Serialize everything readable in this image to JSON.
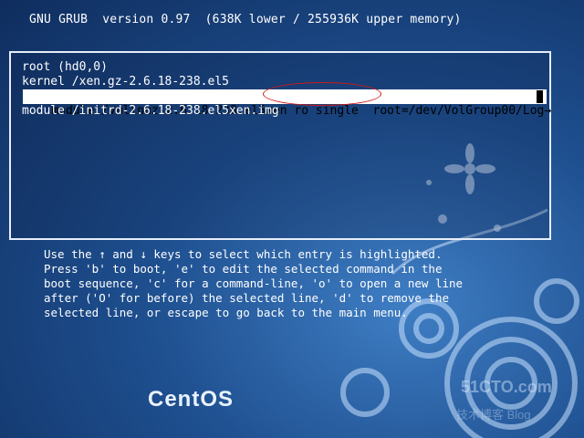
{
  "header": {
    "title": "GNU GRUB  version 0.97  (638K lower / 255936K upper memory)"
  },
  "menu": {
    "entries": [
      {
        "text": "root (hd0,0)",
        "selected": false
      },
      {
        "text": "kernel /xen.gz-2.6.18-238.el5",
        "selected": false
      },
      {
        "text": "module /vmlinuz-2.6.18-238.el5xen ro single  root=/dev/VolGroup00/Log→",
        "selected": true
      },
      {
        "text": "module /initrd-2.6.18-238.el5xen.img",
        "selected": false
      }
    ]
  },
  "help": {
    "lines": [
      "Use the ↑ and ↓ keys to select which entry is highlighted.",
      "Press 'b' to boot, 'e' to edit the selected command in the",
      "boot sequence, 'c' for a command-line, 'o' to open a new line",
      "after ('O' for before) the selected line, 'd' to remove the",
      "selected line, or escape to go back to the main menu."
    ]
  },
  "brand": {
    "logo_text": "CentOS"
  },
  "watermark": {
    "text": "51CTO.com",
    "subtext": "技术博客  Blog"
  },
  "colors": {
    "background": "#1e4f8f",
    "selection_bg": "#ffffff",
    "annotation_oval": "#d01818"
  }
}
